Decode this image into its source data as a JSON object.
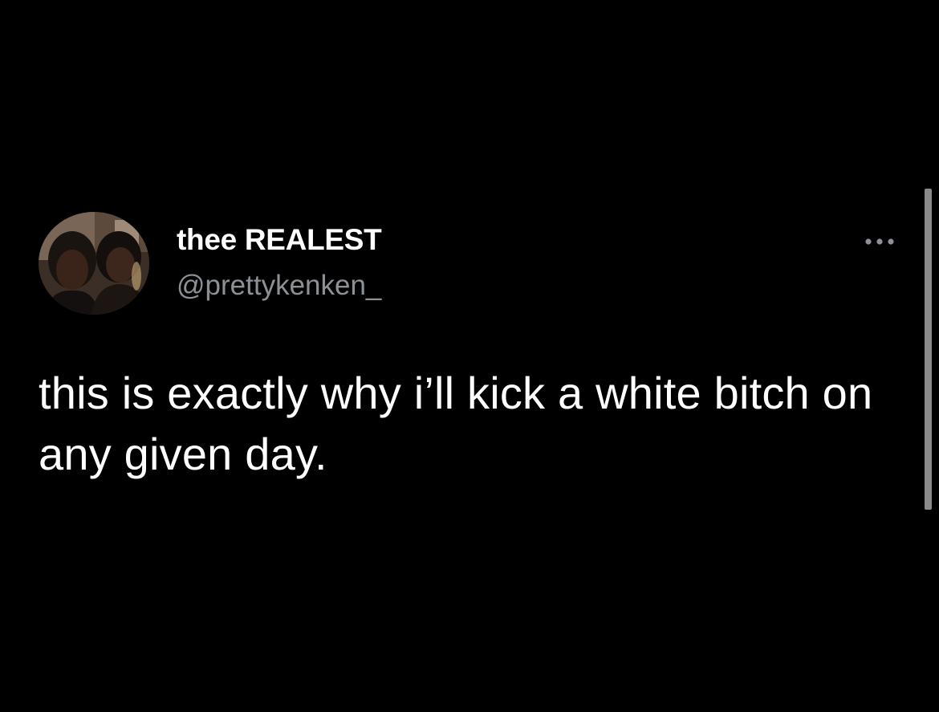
{
  "tweet": {
    "author": {
      "display_name": "thee REALEST",
      "handle": "@prettykenken_"
    },
    "text": "this is exactly why i’ll kick a white bitch on any given day.",
    "more_icon": "more-horizontal-icon"
  },
  "colors": {
    "background": "#000000",
    "text_primary": "#ffffff",
    "text_secondary": "#8b9196",
    "scrollbar": "#8a8a8a"
  }
}
